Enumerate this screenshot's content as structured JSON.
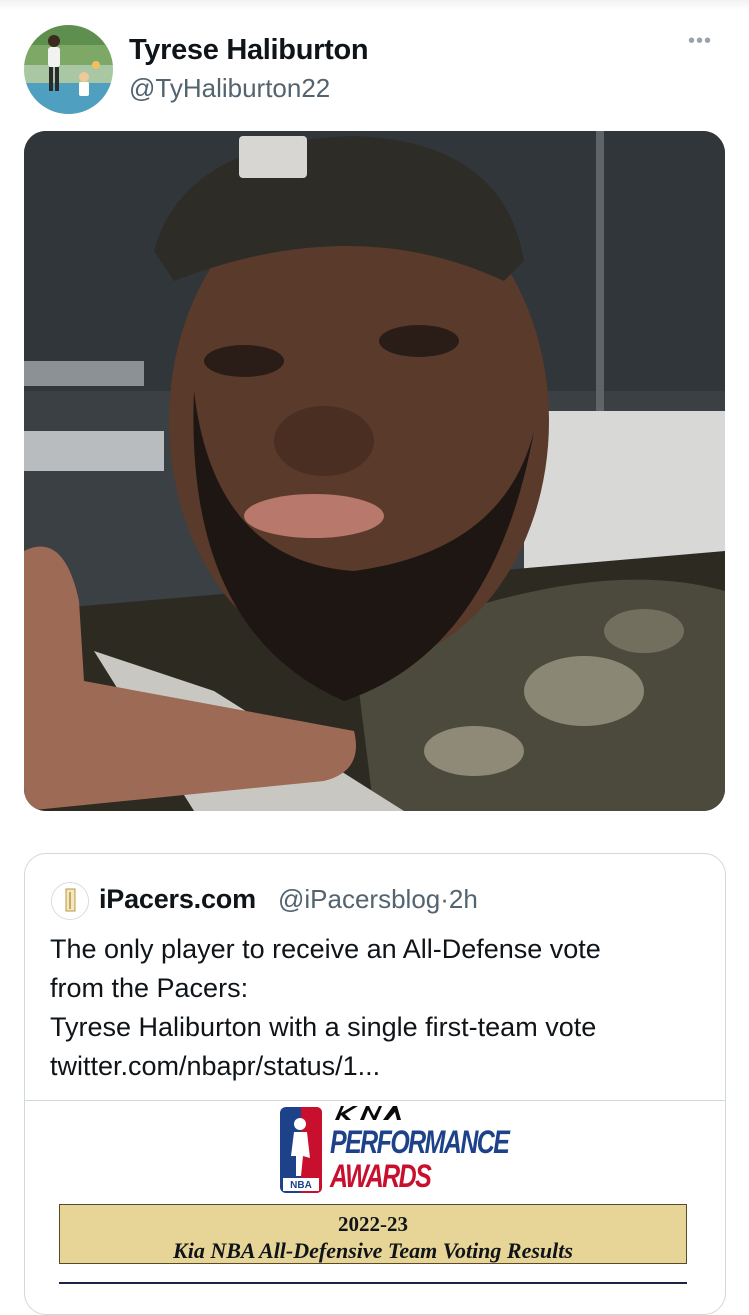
{
  "tweet": {
    "author_name": "Tyrese Haliburton",
    "author_handle": "@TyHaliburton22",
    "more_label": "•••"
  },
  "quoted_tweet": {
    "author_name": "iPacers.com",
    "author_handle": "@iPacersblog",
    "separator": "·",
    "time": "2h",
    "text_lines": [
      "The only player to receive an All-Defense vote",
      "from the Pacers:",
      "Tyrese Haliburton with a single first-team vote",
      "twitter.com/nbapr/status/1..."
    ],
    "card": {
      "brand": "KIA",
      "award_line1": "PERFORMANCE",
      "award_line2": "AWARDS",
      "nba_badge": "NBA",
      "season": "2022-23",
      "subtitle": "Kia NBA All-Defensive Team Voting Results"
    }
  },
  "colors": {
    "text_primary": "#0f1419",
    "text_secondary": "#536471",
    "border": "#cfd9de",
    "nba_blue": "#1d428a",
    "nba_red": "#c8102e",
    "banner_gold": "#e7d497"
  }
}
